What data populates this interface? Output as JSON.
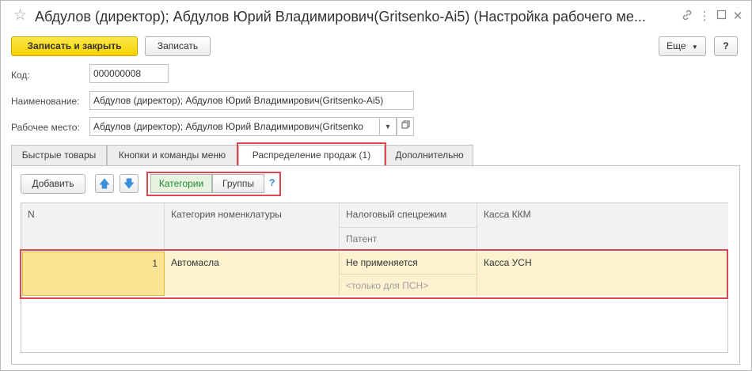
{
  "window": {
    "title": "Абдулов (директор); Абдулов Юрий Владимирович(Gritsenko-Ai5) (Настройка рабочего ме...",
    "icons": [
      "star-icon",
      "link-icon",
      "more-icon",
      "maximize-icon",
      "close-icon"
    ]
  },
  "toolbar": {
    "save_close_label": "Записать и закрыть",
    "save_label": "Записать",
    "more_label": "Еще",
    "help_label": "?"
  },
  "form": {
    "code_label": "Код:",
    "code_value": "000000008",
    "name_label": "Наименование:",
    "name_value": "Абдулов (директор); Абдулов Юрий Владимирович(Gritsenko-Ai5)",
    "workplace_label": "Рабочее место:",
    "workplace_value": "Абдулов (директор); Абдулов Юрий Владимирович(Gritsenko"
  },
  "tabs": [
    {
      "label": "Быстрые товары"
    },
    {
      "label": "Кнопки и команды меню"
    },
    {
      "label": "Распределение продаж (1)"
    },
    {
      "label": "Дополнительно"
    }
  ],
  "panel": {
    "add_label": "Добавить",
    "toggle_categories": "Категории",
    "toggle_groups": "Группы",
    "help_label": "?"
  },
  "table": {
    "headers": {
      "n": "N",
      "category": "Категория номенклатуры",
      "tax": "Налоговый спецрежим",
      "tax_sub": "Патент",
      "cash": "Касса ККМ"
    },
    "rows": [
      {
        "n": "1",
        "category": "Автомасла",
        "tax": "Не применяется",
        "tax_sub": "<только для ПСН>",
        "cash": "Касса УСН"
      }
    ]
  },
  "colors": {
    "primary_button": "#f6d100",
    "highlight_frame": "#e0464f",
    "selected_row": "#fcf2cf",
    "active_toggle": "#1c8a32"
  }
}
